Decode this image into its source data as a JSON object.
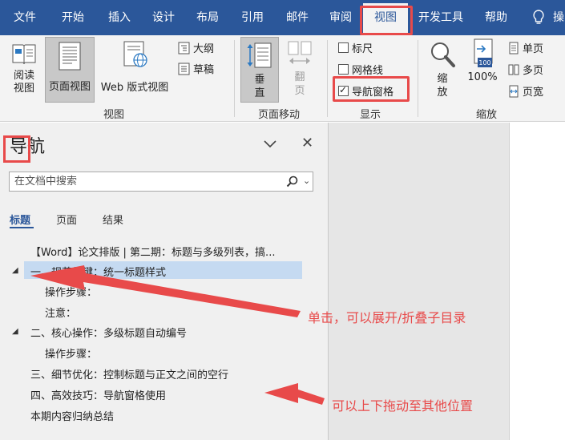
{
  "tabs": [
    "文件",
    "开始",
    "插入",
    "设计",
    "布局",
    "引用",
    "邮件",
    "审阅",
    "视图",
    "开发工具",
    "帮助"
  ],
  "tab_tail": "操",
  "active_tab": "视图",
  "ribbon": {
    "views": {
      "read_mode": "阅读\n视图",
      "print_layout": "页面视图",
      "web_layout": "Web 版式视图",
      "outline": "大纲",
      "draft": "草稿",
      "group_label": "视图"
    },
    "page_movement": {
      "vertical": "垂\n直",
      "side_to_side": "翻\n页",
      "group_label": "页面移动"
    },
    "show": {
      "ruler": "标尺",
      "gridlines": "网格线",
      "navigation_pane": "导航窗格",
      "ruler_checked": false,
      "gridlines_checked": false,
      "navigation_pane_checked": true,
      "group_label": "显示"
    },
    "zoom": {
      "zoom": "缩\n放",
      "hundred": "100%",
      "one_page": "单页",
      "multiple_pages": "多页",
      "page_width": "页宽",
      "group_label": "缩放",
      "icon_text": "100"
    }
  },
  "nav": {
    "title": "导航",
    "search_placeholder": "在文档中搜索",
    "tabs": [
      "标题",
      "页面",
      "结果"
    ],
    "outline": [
      "【Word】论文排版 | 第二期：标题与多级列表，搞...",
      "一、规范关键：统一标题样式",
      "操作步骤：",
      "注意：",
      "二、核心操作：多级标题自动编号",
      "操作步骤：",
      "三、细节优化：控制标题与正文之间的空行",
      "四、高效技巧：导航窗格使用",
      "本期内容归纳总结"
    ]
  },
  "annotations": {
    "expand": "单击，可以展开/折叠子目录",
    "drag": "可以上下拖动至其他位置"
  },
  "colors": {
    "tab_bar": "#2b579a",
    "highlight": "#e84a4a",
    "selected_row": "#c5daf1"
  }
}
